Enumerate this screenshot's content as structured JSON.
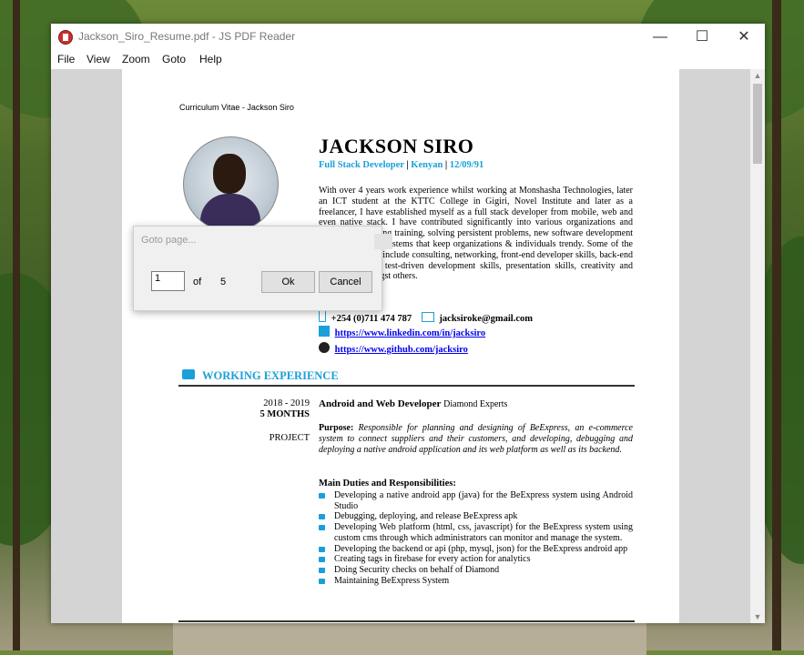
{
  "window": {
    "title": "Jackson_Siro_Resume.pdf - JS PDF Reader",
    "controls": {
      "minimize": "—",
      "maximize": "☐",
      "close": "✕"
    }
  },
  "menu": [
    "File",
    "View",
    "Zoom",
    "Goto",
    "Help"
  ],
  "document": {
    "header": "Curriculum Vitae - Jackson Siro",
    "name": "JACKSON SIRO",
    "role": "Full Stack Developer",
    "country": "Kenyan",
    "dob": "12/09/91",
    "summary": "With over 4 years work experience whilst working at Monshasha Technologies, later an ICT student at the KTTC College in Gigiri, Novel Institute and later as a freelancer, I have established myself as a full stack developer from mobile, web and even native stack. I have contributed significantly into various organizations and initiatives including training, solving persistent problems, new software development and designing of systems that keep organizations & individuals trendy. Some of the key skills gained include consulting, networking, front-end developer skills, back-end developer skills, test-driven development skills, presentation skills, creativity and innovation amongst others.",
    "phone": "+254 (0)711 474 787",
    "email": "jacksiroke@gmail.com",
    "linkedin": "https://www.linkedin.com/in/jacksiro",
    "github": "https://www.github.com/jacksiro",
    "section_title": "WORKING EXPERIENCE",
    "job": {
      "period": "2018 - 2019",
      "duration": "5 MONTHS",
      "kind": "PROJECT",
      "title": "Android and Web Developer",
      "company": "Diamond Experts",
      "purpose_label": "Purpose:",
      "purpose": "Responsible for planning and designing of BeExpress, an e-commerce system to connect suppliers and their customers, and developing, debugging and deploying a native android application and its web platform as well as its backend.",
      "duties_title": "Main Duties and Responsibilities:",
      "duties": [
        "Developing a native android app (java) for the BeExpress system using Android Studio",
        "Debugging, deploying, and release BeExpress apk",
        "Developing Web platform (html, css, javascript) for the BeExpress system using custom cms through which administrators can monitor and manage the system.",
        "Developing the backend or api (php, mysql, json) for the BeExpress android app",
        "Creating tags in firebase for every action for analytics",
        "Doing Security checks on behalf of Diamond",
        "Maintaining BeExpress System"
      ]
    }
  },
  "goto_dialog": {
    "title": "Goto page...",
    "page_value": "1",
    "of_label": "of",
    "total_pages": "5",
    "ok_label": "Ok",
    "cancel_label": "Cancel"
  },
  "colors": {
    "accent": "#1aa0d8",
    "link": "#0000ee"
  }
}
